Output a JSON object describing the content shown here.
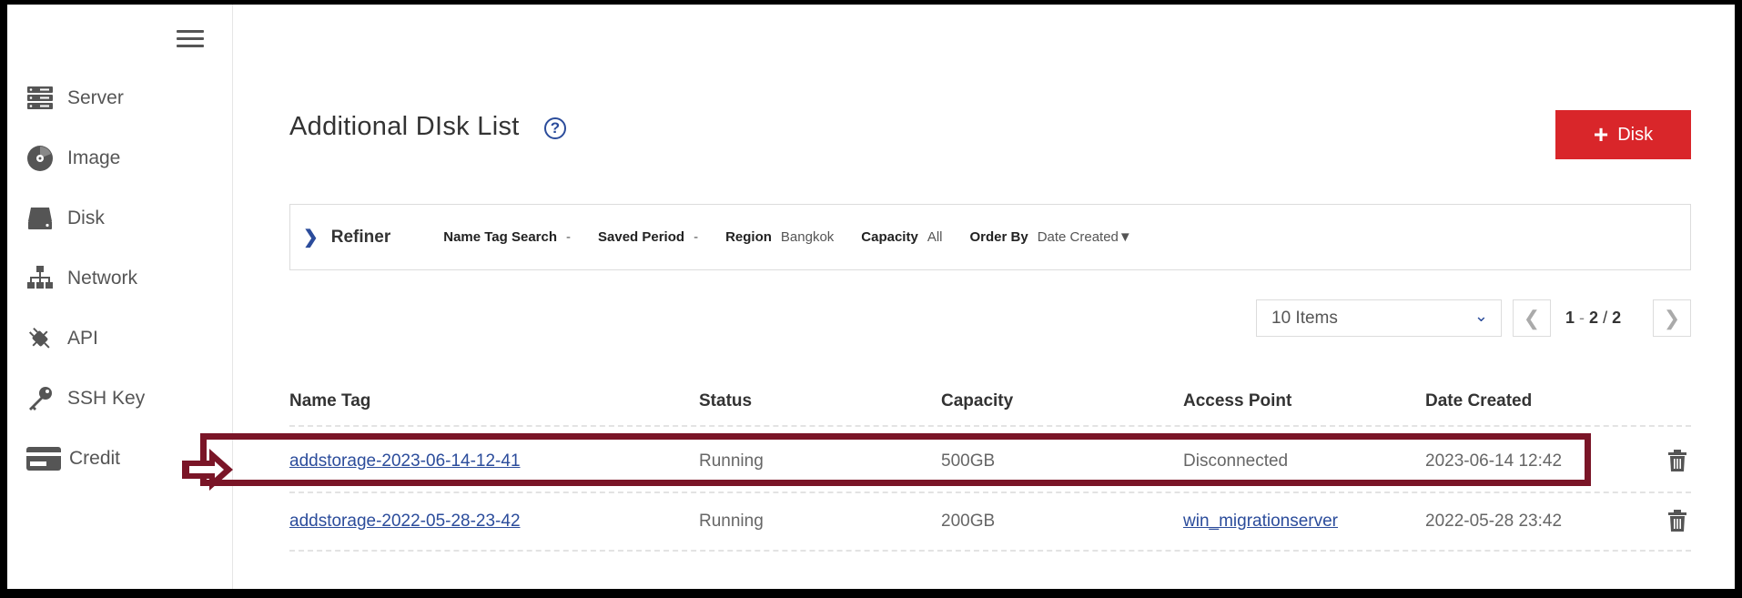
{
  "sidebar": {
    "items": [
      {
        "label": "Server",
        "icon": "server-icon"
      },
      {
        "label": "Image",
        "icon": "disc-icon"
      },
      {
        "label": "Disk",
        "icon": "disk-icon"
      },
      {
        "label": "Network",
        "icon": "network-icon"
      },
      {
        "label": "API",
        "icon": "plug-icon"
      },
      {
        "label": "SSH Key",
        "icon": "key-icon"
      },
      {
        "label": "Credit",
        "icon": "credit-card-icon"
      }
    ]
  },
  "header": {
    "title": "Additional DIsk List",
    "help": "?",
    "add_button_plus": "+",
    "add_button_label": "Disk"
  },
  "refiner": {
    "toggle": "❯",
    "title": "Refiner",
    "filters": [
      {
        "label": "Name Tag Search",
        "value": "-"
      },
      {
        "label": "Saved Period",
        "value": "-"
      },
      {
        "label": "Region",
        "value": "Bangkok"
      },
      {
        "label": "Capacity",
        "value": "All"
      },
      {
        "label": "Order By",
        "value": "Date Created▼"
      }
    ]
  },
  "pagination": {
    "per_page": "10 Items",
    "chevron": "⌄",
    "prev": "❮",
    "next": "❯",
    "start": "1",
    "dash": "-",
    "end": "2",
    "slash": "/",
    "total": "2"
  },
  "table": {
    "columns": [
      "Name Tag",
      "Status",
      "Capacity",
      "Access Point",
      "Date Created"
    ],
    "rows": [
      {
        "name_tag": "addstorage-2023-06-14-12-41",
        "status": "Running",
        "capacity": "500GB",
        "access_point": "Disconnected",
        "date_created": "2023-06-14 12:42"
      },
      {
        "name_tag": "addstorage-2022-05-28-23-42",
        "status": "Running",
        "capacity": "200GB",
        "access_point": "win_migrationserver",
        "date_created": "2022-05-28 23:42"
      }
    ]
  },
  "colors": {
    "accent": "#2b4c9b",
    "danger": "#d9262a",
    "highlight": "#7a1527"
  }
}
